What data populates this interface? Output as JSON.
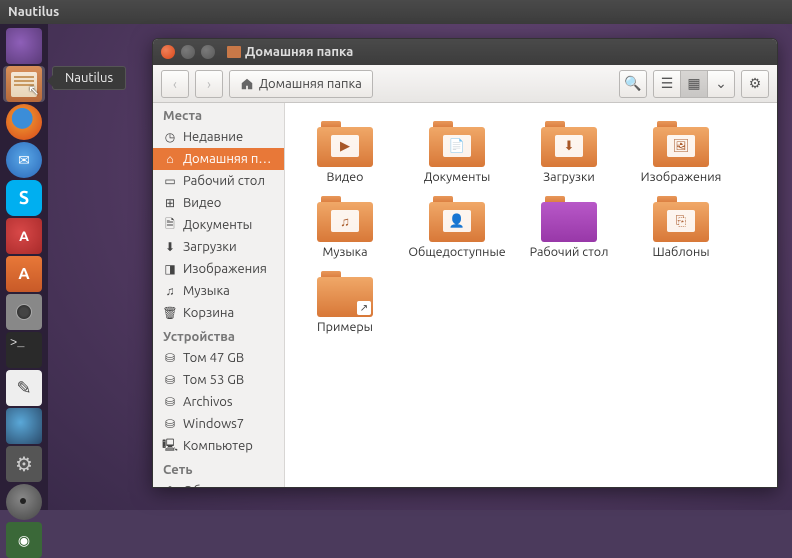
{
  "top_panel": {
    "app_name": "Nautilus"
  },
  "tooltip": "Nautilus",
  "window": {
    "title": "Домашняя папка",
    "toolbar": {
      "location": {
        "label": "Домашняя папка"
      }
    }
  },
  "sidebar": {
    "sections": [
      {
        "header": "Места",
        "items": [
          {
            "icon": "clock",
            "label": "Недавние",
            "selected": false
          },
          {
            "icon": "home",
            "label": "Домашняя п…",
            "selected": true
          },
          {
            "icon": "desktop",
            "label": "Рабочий стол",
            "selected": false
          },
          {
            "icon": "video",
            "label": "Видео",
            "selected": false
          },
          {
            "icon": "doc",
            "label": "Документы",
            "selected": false
          },
          {
            "icon": "download",
            "label": "Загрузки",
            "selected": false
          },
          {
            "icon": "image",
            "label": "Изображения",
            "selected": false
          },
          {
            "icon": "music",
            "label": "Музыка",
            "selected": false
          },
          {
            "icon": "trash",
            "label": "Корзина",
            "selected": false
          }
        ]
      },
      {
        "header": "Устройства",
        "items": [
          {
            "icon": "hdd",
            "label": "Том 47 GB",
            "selected": false
          },
          {
            "icon": "hdd",
            "label": "Том 53 GB",
            "selected": false
          },
          {
            "icon": "hdd",
            "label": "Archivos",
            "selected": false
          },
          {
            "icon": "hdd",
            "label": "Windows7",
            "selected": false
          },
          {
            "icon": "computer",
            "label": "Компьютер",
            "selected": false
          }
        ]
      },
      {
        "header": "Сеть",
        "items": [
          {
            "icon": "network",
            "label": "Обзор сети",
            "selected": false
          }
        ]
      }
    ]
  },
  "folders": [
    {
      "name": "Видео",
      "badge": "▶",
      "variant": ""
    },
    {
      "name": "Документы",
      "badge": "📄",
      "variant": ""
    },
    {
      "name": "Загрузки",
      "badge": "⬇",
      "variant": ""
    },
    {
      "name": "Изображения",
      "badge": "🖼",
      "variant": ""
    },
    {
      "name": "Музыка",
      "badge": "♫",
      "variant": ""
    },
    {
      "name": "Общедоступные",
      "badge": "👤",
      "variant": ""
    },
    {
      "name": "Рабочий стол",
      "badge": "",
      "variant": "desktop"
    },
    {
      "name": "Шаблоны",
      "badge": "⎘",
      "variant": ""
    },
    {
      "name": "Примеры",
      "badge": "",
      "variant": "examples"
    }
  ],
  "icons": {
    "clock": "◷",
    "home": "⌂",
    "desktop": "▭",
    "video": "⊞",
    "doc": "🗎",
    "download": "⬇",
    "image": "◨",
    "music": "♫",
    "trash": "🗑",
    "hdd": "⛁",
    "computer": "🖳",
    "network": "⌬"
  }
}
